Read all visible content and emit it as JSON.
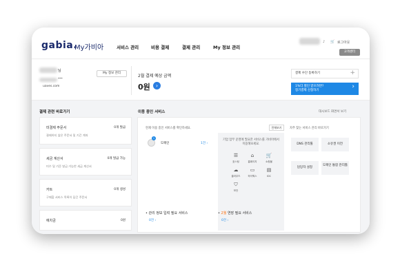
{
  "header": {
    "logo": "gabia.",
    "logo_kr": "My가비아",
    "nav": [
      "서비스 관리",
      "비용 결제",
      "결제 관리",
      "My 정보 관리"
    ],
    "login": "로그아웃",
    "cs": "고객센터"
  },
  "account": {
    "name_suffix": "님",
    "email_tail": "***",
    "email_domain": "uaves.com",
    "info_btn": "My 정보 관리"
  },
  "billing": {
    "label": "2월 결제 예상 금액",
    "amount": "0원",
    "register": "결제 수단 등록하기",
    "promo_line1": "1%더 할인 받으려면?",
    "promo_line2": "정기결제 신청하기"
  },
  "payment_shortcuts": {
    "title": "결제 관련 바로가기",
    "cards": [
      {
        "title": "미결제 주문서",
        "sub": "결제하지 않은 주문서 및 기간 계좌",
        "value": "0개 발급"
      },
      {
        "title": "세금 계산서",
        "sub": "미수 및 기준 발급 가능한 세금 계산서",
        "value": "0개 발급 가능"
      },
      {
        "title": "카트",
        "sub": "구매할 서비스 목록이 담긴 주문서",
        "value": "0개 생성"
      },
      {
        "title": "예치금",
        "sub": "",
        "value": "0원"
      }
    ]
  },
  "services": {
    "title": "이용 중인 서비스",
    "dashboard_link": "대시보드 화면서 보기",
    "hint": "현재 이용 중인 서비스를 확인하세요.",
    "detail_btn": "전체보기",
    "domain_label": "도메인",
    "domain_count": "1건",
    "domain_badge": "1",
    "other_text": "기업 업무 운영에 필요한 서비스를 가비아에서 이용해보세요.",
    "icons": [
      {
        "name": "호스팅",
        "icon": "list-icon"
      },
      {
        "name": "홈페이지",
        "icon": "home-icon"
      },
      {
        "name": "쇼핑몰",
        "icon": "cart-icon"
      },
      {
        "name": "클라우드",
        "icon": "cloud-icon"
      },
      {
        "name": "하이웍스",
        "icon": "briefcase-icon"
      },
      {
        "name": "IDC",
        "icon": "server-icon"
      },
      {
        "name": "보안",
        "icon": "shield-icon"
      }
    ],
    "quick_hint": "자주 찾는 서비스 관리 바로가기",
    "quick": [
      "DNS 관리툴",
      "소유권 이전",
      "담당자 설정",
      "도메인 통합 관리툴"
    ],
    "bottom_left_title": "관리 정보 입력 필요 서비스",
    "bottom_left_value": "0건",
    "bottom_right_prefix": "2월",
    "bottom_right_title": "연장 필요 서비스",
    "bottom_right_value": "0건"
  }
}
